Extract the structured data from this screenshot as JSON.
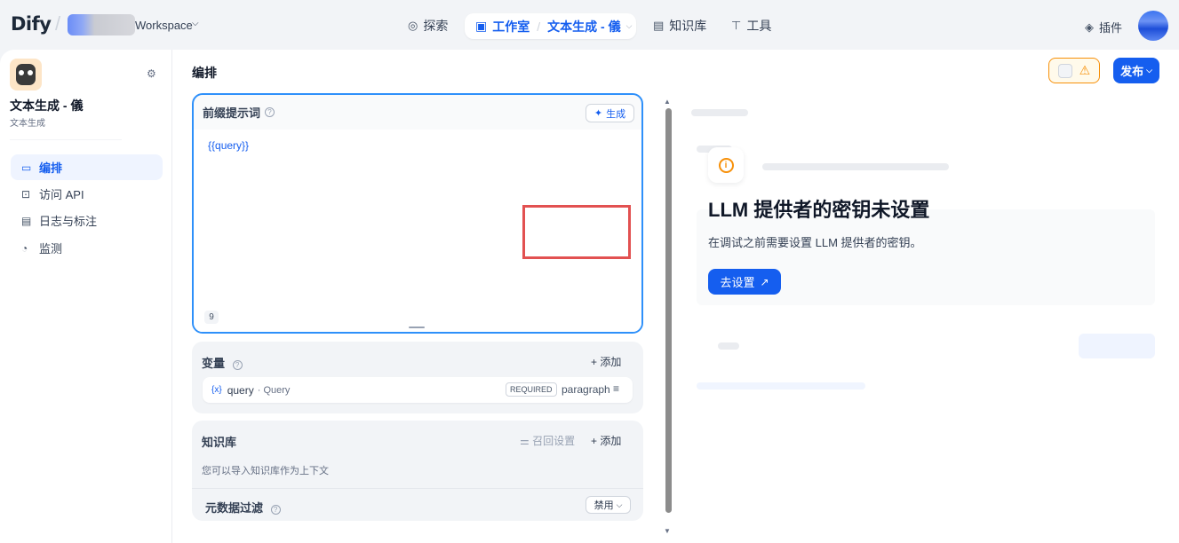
{
  "topbar": {
    "logo": "Dify",
    "workspace_label": "Workspace",
    "nav_explore": "探索",
    "nav_studio": "工作室",
    "nav_app": "文本生成 - 儀",
    "nav_knowledge": "知识库",
    "nav_tools": "工具",
    "plugins": "插件"
  },
  "sidebar": {
    "app_name": "文本生成 - 儀",
    "app_type": "文本生成",
    "items": [
      {
        "label": "编排",
        "icon": "layout-icon",
        "active": true
      },
      {
        "label": "访问 API",
        "icon": "terminal-icon",
        "active": false
      },
      {
        "label": "日志与标注",
        "icon": "file-list-icon",
        "active": false
      },
      {
        "label": "监测",
        "icon": "dashboard-icon",
        "active": false
      }
    ]
  },
  "main": {
    "title": "编排",
    "publish_label": "发布"
  },
  "prompt": {
    "label": "前缀提示词",
    "generate_label": "生成",
    "text": "{{query}}",
    "char_count": "9"
  },
  "variables": {
    "label": "变量",
    "add_label": "添加",
    "rows": [
      {
        "key": "query",
        "name": "Query",
        "required": "REQUIRED",
        "type": "paragraph"
      }
    ]
  },
  "knowledge": {
    "label": "知识库",
    "recall_label": "召回设置",
    "add_label": "添加",
    "description": "您可以导入知识库作为上下文",
    "metadata_label": "元数据过滤",
    "metadata_value": "禁用"
  },
  "overlay": {
    "title": "LLM 提供者的密钥未设置",
    "description": "在调试之前需要设置 LLM 提供者的密钥。",
    "button": "去设置"
  },
  "colors": {
    "accent": "#155eef",
    "warning": "#f79009",
    "highlight": "#e25151"
  }
}
